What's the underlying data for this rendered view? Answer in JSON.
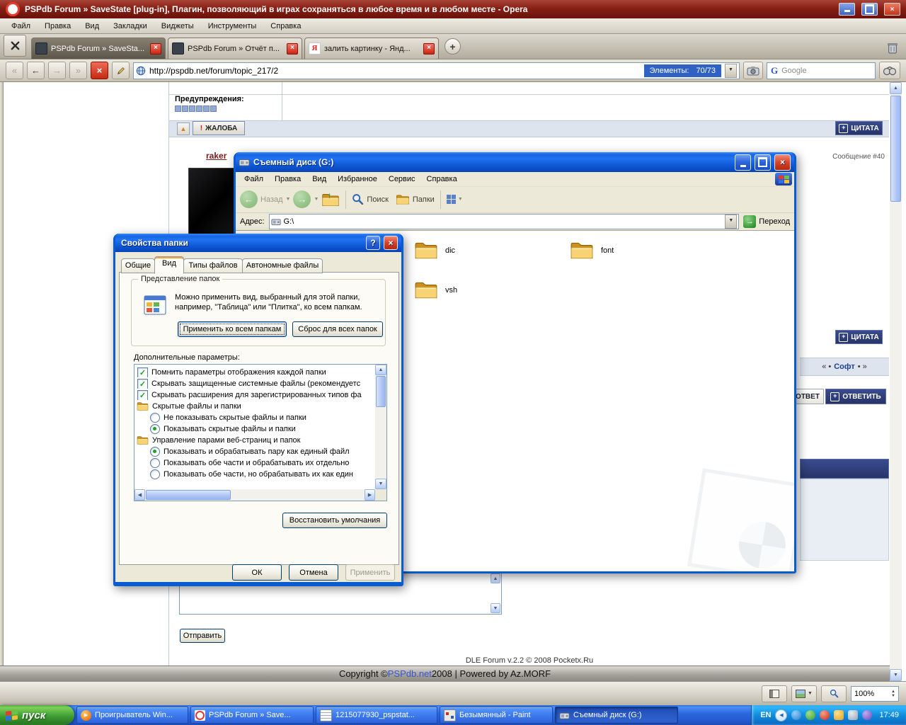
{
  "opera": {
    "title": "PSPdb Forum » SaveState [plug-in], Плагин, позволяющий в играх сохраняться в любое время и в любом месте - Opera",
    "menu": [
      "Файл",
      "Правка",
      "Вид",
      "Закладки",
      "Виджеты",
      "Инструменты",
      "Справка"
    ],
    "tabs": [
      {
        "label": "PSPdb Forum » SaveSta...",
        "active": true
      },
      {
        "label": "PSPdb Forum » Отчёт п...",
        "active": false
      },
      {
        "label": "залить картинку - Янд...",
        "active": false
      }
    ],
    "address": "http://pspdb.net/forum/topic_217/2",
    "elements_label": "Элементы:",
    "elements_value": "70/73",
    "search_icon": "G",
    "search_label": "Google",
    "zoom": "100%"
  },
  "forum": {
    "warnings_label": "Предупреждения:",
    "report_button": "ЖАЛОБА",
    "quote_button": "ЦИТАТА",
    "username": "raker",
    "message_no": "Сообщение #40",
    "soft_left": "«  •",
    "soft_link": "Софт",
    "soft_right": "• »",
    "reply_button": "ОТВЕТ",
    "answer_button": "ОТВЕТИТЬ",
    "send_button": "Отправить",
    "footer_engine": "DLE Forum v.2.2 © 2008 Pocketx.Ru",
    "copyright_pre": "Copyright © ",
    "copyright_link": "PSPdb.net",
    "copyright_post": " 2008 | Powered by Az.MORF"
  },
  "explorer": {
    "title": "Съемный диск (G:)",
    "menu": [
      "Файл",
      "Правка",
      "Вид",
      "Избранное",
      "Сервис",
      "Справка"
    ],
    "toolbar": {
      "back": "Назад",
      "search": "Поиск",
      "folders": "Папки"
    },
    "address_label": "Адрес:",
    "address_value": "G:\\",
    "go_button": "Переход",
    "files": [
      "dic",
      "font",
      "vsh"
    ]
  },
  "dialog": {
    "title": "Свойства папки",
    "tabs": [
      "Общие",
      "Вид",
      "Типы файлов",
      "Автономные файлы"
    ],
    "active_tab": "Вид",
    "group_title": "Представление папок",
    "group_text": "Можно применить вид, выбранный для этой папки, например, \"Таблица\" или \"Плитка\", ко всем папкам.",
    "apply_all_button": "Применить ко всем папкам",
    "reset_all_button": "Сброс для всех папок",
    "params_label": "Дополнительные параметры:",
    "list": [
      {
        "type": "checkbox",
        "checked": true,
        "label": "Помнить параметры отображения каждой папки"
      },
      {
        "type": "checkbox",
        "checked": true,
        "label": "Скрывать защищенные системные файлы (рекомендуетс"
      },
      {
        "type": "checkbox",
        "checked": true,
        "label": "Скрывать расширения для зарегистрированных типов фа"
      },
      {
        "type": "folder",
        "checked": null,
        "label": "Скрытые файлы и папки"
      },
      {
        "type": "radio",
        "checked": false,
        "label": "Не показывать скрытые файлы и папки"
      },
      {
        "type": "radio",
        "checked": true,
        "label": "Показывать скрытые файлы и папки"
      },
      {
        "type": "folder",
        "checked": null,
        "label": "Управление парами веб-страниц и папок"
      },
      {
        "type": "radio",
        "checked": true,
        "label": "Показывать и обрабатывать пару как единый файл"
      },
      {
        "type": "radio",
        "checked": false,
        "label": "Показывать обе части и обрабатывать их отдельно"
      },
      {
        "type": "radio",
        "checked": false,
        "label": "Показывать обе части, но обрабатывать их как един"
      }
    ],
    "restore_button": "Восстановить умолчания",
    "ok_button": "ОК",
    "cancel_button": "Отмена",
    "apply_button": "Применить"
  },
  "taskbar": {
    "start": "пуск",
    "tasks": [
      {
        "label": "Проигрыватель Win...",
        "icon": "wmp-icon",
        "active": false
      },
      {
        "label": "PSPdb Forum » Save...",
        "icon": "opera-icon",
        "active": false
      },
      {
        "label": "1215077930_pspstat...",
        "icon": "notepad-icon",
        "active": false
      },
      {
        "label": "Безымянный - Paint",
        "icon": "paint-icon",
        "active": false
      },
      {
        "label": "Съемный диск (G:)",
        "icon": "disk-icon",
        "active": true
      }
    ],
    "lang": "EN",
    "time": "17:49"
  }
}
